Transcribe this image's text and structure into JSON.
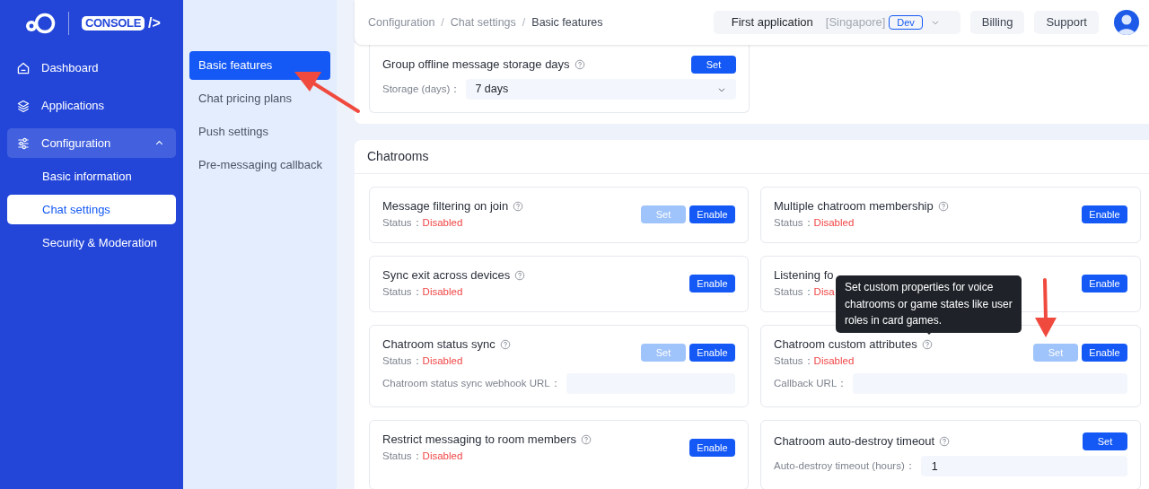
{
  "logo": {
    "badge": "CONSOLE",
    "mark": "/>"
  },
  "sidebar": {
    "items": [
      {
        "label": "Dashboard",
        "selected": false
      },
      {
        "label": "Applications",
        "selected": false
      },
      {
        "label": "Configuration",
        "selected": false,
        "expanded": true,
        "children": [
          {
            "label": "Basic information",
            "selected": false
          },
          {
            "label": "Chat settings",
            "selected": true
          },
          {
            "label": "Security & Moderation",
            "selected": false
          }
        ]
      }
    ]
  },
  "submenu": {
    "items": [
      {
        "label": "Basic features",
        "selected": true
      },
      {
        "label": "Chat pricing plans",
        "selected": false
      },
      {
        "label": "Push settings",
        "selected": false
      },
      {
        "label": "Pre-messaging callback",
        "selected": false
      }
    ]
  },
  "breadcrumb": {
    "separator": "/",
    "items": [
      "Configuration",
      "Chat settings",
      "Basic features"
    ]
  },
  "app_selector": {
    "name": "First application",
    "region": "[Singapore]",
    "env": "Dev"
  },
  "header_buttons": [
    "Billing",
    "Support"
  ],
  "top_card": {
    "title": "Group offline message storage days",
    "buttons": [
      {
        "label": "Set",
        "disabled": false
      }
    ],
    "field": {
      "kind": "select",
      "label": "Storage (days)：",
      "value": "7 days"
    }
  },
  "section": {
    "title": "Chatrooms",
    "features": [
      {
        "title": "Message filtering on join",
        "status_label": "Status：",
        "status": "Disabled",
        "buttons": [
          {
            "label": "Set",
            "disabled": true
          },
          {
            "label": "Enable",
            "disabled": false
          }
        ]
      },
      {
        "title": "Multiple chatroom membership",
        "status_label": "Status：",
        "status": "Disabled",
        "buttons": [
          {
            "label": "Enable",
            "disabled": false
          }
        ]
      },
      {
        "title": "Sync exit across devices",
        "status_label": "Status：",
        "status": "Disabled",
        "buttons": [
          {
            "label": "Enable",
            "disabled": false
          }
        ]
      },
      {
        "title": "Listening fo",
        "kind": "partial",
        "status_label": "Status：",
        "status": "Disa",
        "buttons": [
          {
            "label": "Enable",
            "disabled": false
          }
        ]
      },
      {
        "title": "Chatroom status sync",
        "status_label": "Status：",
        "status": "Disabled",
        "buttons": [
          {
            "label": "Set",
            "disabled": true
          },
          {
            "label": "Enable",
            "disabled": false
          }
        ],
        "field": {
          "kind": "input",
          "label": "Chatroom status sync webhook URL："
        }
      },
      {
        "title": "Chatroom custom attributes",
        "status_label": "Status：",
        "status": "Disabled",
        "buttons": [
          {
            "label": "Set",
            "disabled": true
          },
          {
            "label": "Enable",
            "disabled": false
          }
        ],
        "field": {
          "kind": "input",
          "label": "Callback URL："
        }
      },
      {
        "title": "Restrict messaging to room members",
        "status_label": "Status：",
        "status": "Disabled",
        "buttons": [
          {
            "label": "Enable",
            "disabled": false
          }
        ]
      },
      {
        "title": "Chatroom auto-destroy timeout",
        "buttons": [
          {
            "label": "Set",
            "disabled": false
          }
        ],
        "field": {
          "kind": "input",
          "label": "Auto-destroy timeout (hours)：",
          "value": "1"
        }
      }
    ]
  },
  "tooltip": {
    "text": "Set custom properties for voice chatrooms or game states like user roles in card games."
  }
}
